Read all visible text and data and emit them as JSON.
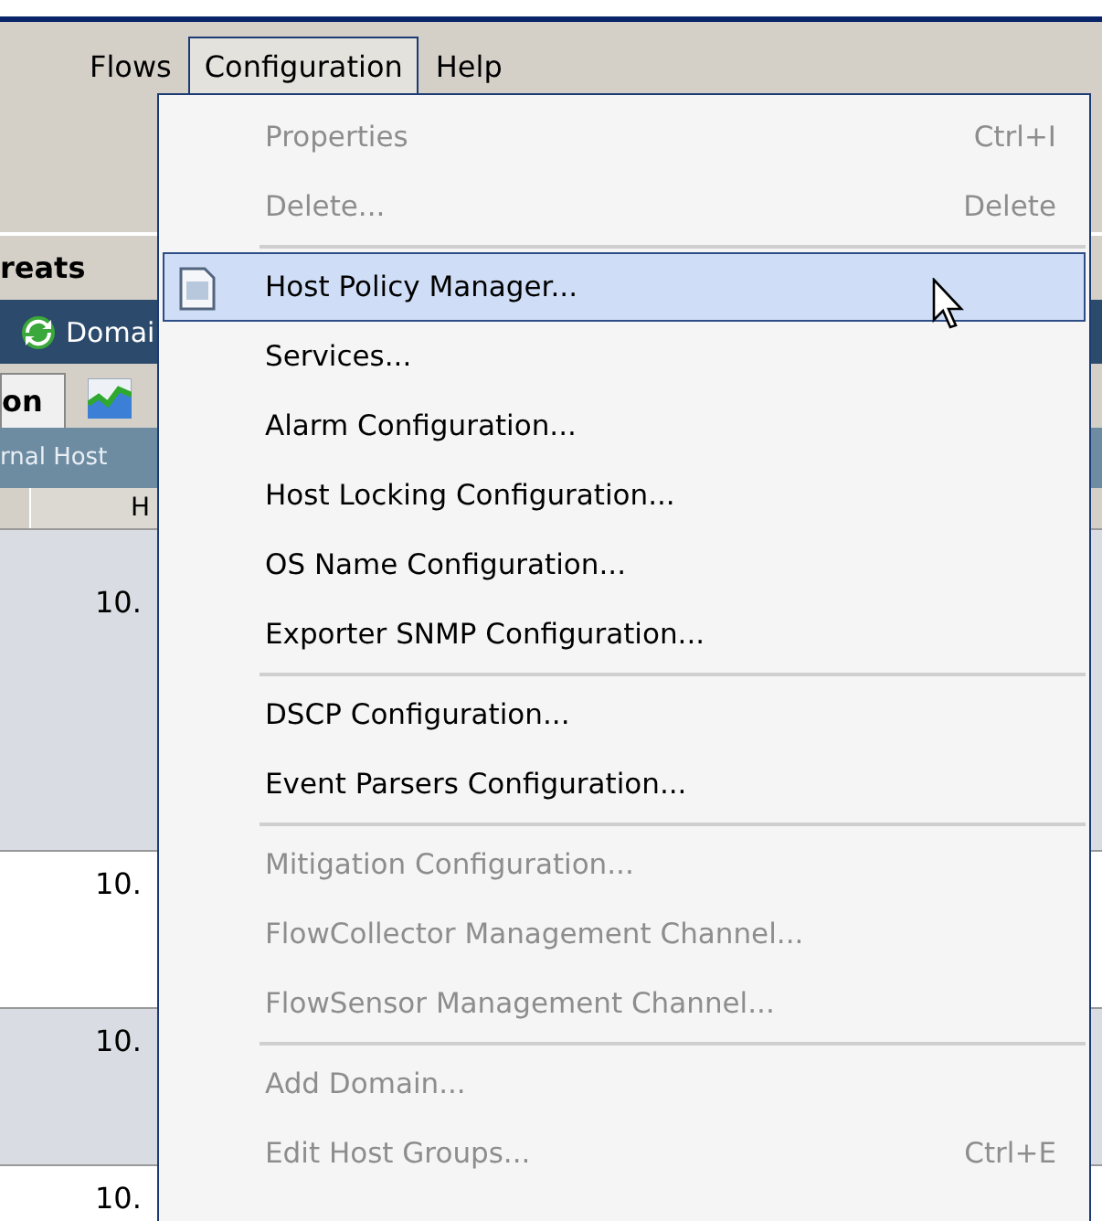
{
  "menubar": [
    {
      "label": "Flows",
      "selected": false
    },
    {
      "label": "Configuration",
      "selected": true
    },
    {
      "label": "Help",
      "selected": false
    }
  ],
  "menu": {
    "items": [
      {
        "kind": "item",
        "label": "Properties",
        "shortcut": "Ctrl+I",
        "disabled": true,
        "selected": false
      },
      {
        "kind": "item",
        "label": "Delete...",
        "shortcut": "Delete",
        "disabled": true,
        "selected": false
      },
      {
        "kind": "separator"
      },
      {
        "kind": "item",
        "label": "Host Policy Manager...",
        "disabled": false,
        "selected": true,
        "icon": true
      },
      {
        "kind": "item",
        "label": "Services...",
        "disabled": false,
        "selected": false
      },
      {
        "kind": "item",
        "label": "Alarm Configuration...",
        "disabled": false,
        "selected": false
      },
      {
        "kind": "item",
        "label": "Host Locking Configuration...",
        "disabled": false,
        "selected": false
      },
      {
        "kind": "item",
        "label": "OS Name Configuration...",
        "disabled": false,
        "selected": false
      },
      {
        "kind": "item",
        "label": "Exporter SNMP Configuration...",
        "disabled": false,
        "selected": false
      },
      {
        "kind": "separator"
      },
      {
        "kind": "item",
        "label": "DSCP Configuration...",
        "disabled": false,
        "selected": false
      },
      {
        "kind": "item",
        "label": "Event Parsers Configuration...",
        "disabled": false,
        "selected": false
      },
      {
        "kind": "separator"
      },
      {
        "kind": "item",
        "label": "Mitigation Configuration...",
        "disabled": true,
        "selected": false
      },
      {
        "kind": "item",
        "label": "FlowCollector Management Channel...",
        "disabled": true,
        "selected": false
      },
      {
        "kind": "item",
        "label": "FlowSensor Management Channel...",
        "disabled": true,
        "selected": false
      },
      {
        "kind": "separator"
      },
      {
        "kind": "item",
        "label": "Add Domain...",
        "disabled": true,
        "selected": false
      },
      {
        "kind": "item",
        "label": "Edit Host Groups...",
        "shortcut": "Ctrl+E",
        "disabled": true,
        "selected": false
      }
    ]
  },
  "background": {
    "tab_1": "reats",
    "toolbar_label": "Domai",
    "tab_2": "on",
    "panel_title": "rnal Host",
    "column_header": "H",
    "rows": [
      "10.",
      "10.",
      "10.",
      "10."
    ]
  }
}
